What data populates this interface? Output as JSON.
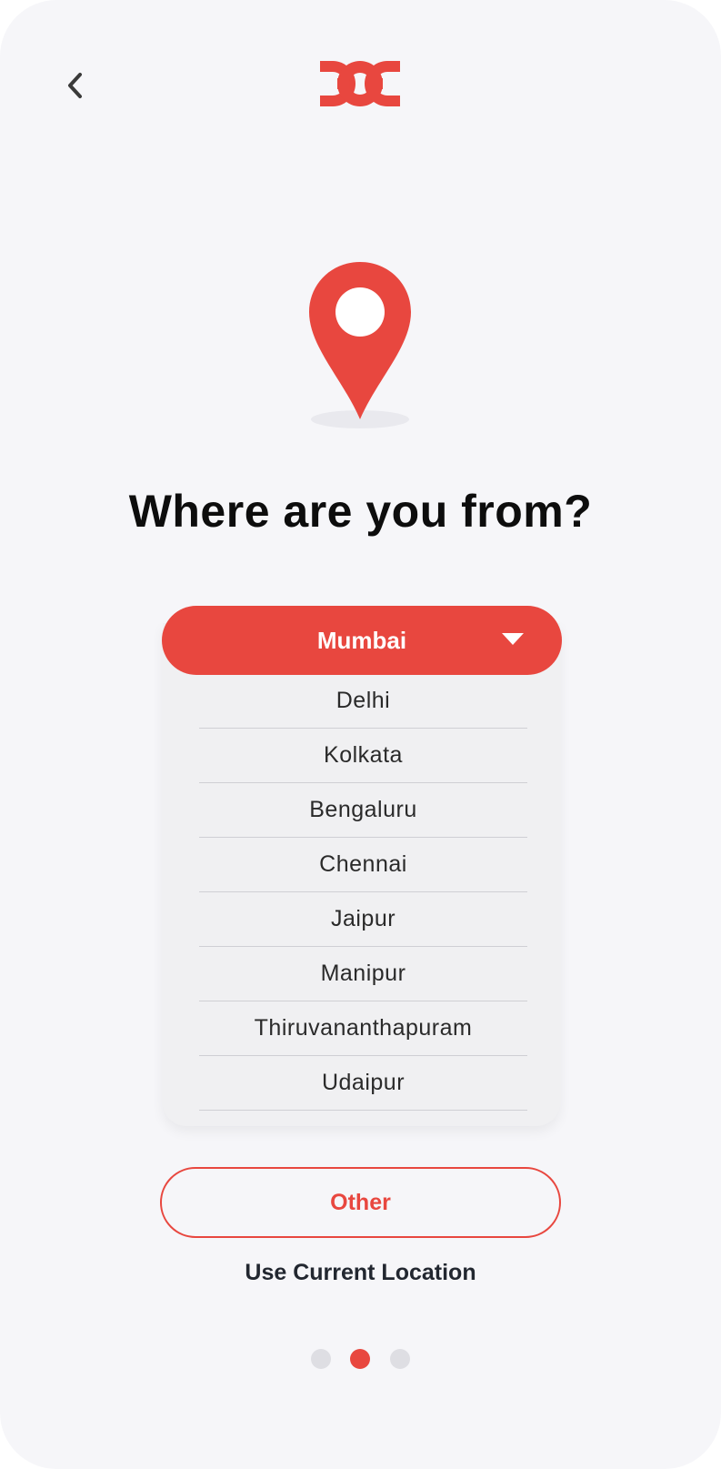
{
  "header": {
    "back_icon": "chevron-left-icon",
    "logo_icon": "doc-logo-icon"
  },
  "hero": {
    "icon": "location-pin-icon",
    "title": "Where are you from?"
  },
  "city_select": {
    "selected": "Mumbai",
    "caret_icon": "caret-down-icon",
    "options": [
      "Delhi",
      "Kolkata",
      "Bengaluru",
      "Chennai",
      "Jaipur",
      "Manipur",
      "Thiruvananthapuram",
      "Udaipur"
    ]
  },
  "actions": {
    "other_label": "Other",
    "current_location_label": "Use Current Location"
  },
  "pagination": {
    "total": 3,
    "active_index": 1
  },
  "colors": {
    "accent": "#e8473f",
    "background": "#f6f6f9",
    "text_primary": "#0d0d0d",
    "dot_inactive": "#dedee3"
  }
}
